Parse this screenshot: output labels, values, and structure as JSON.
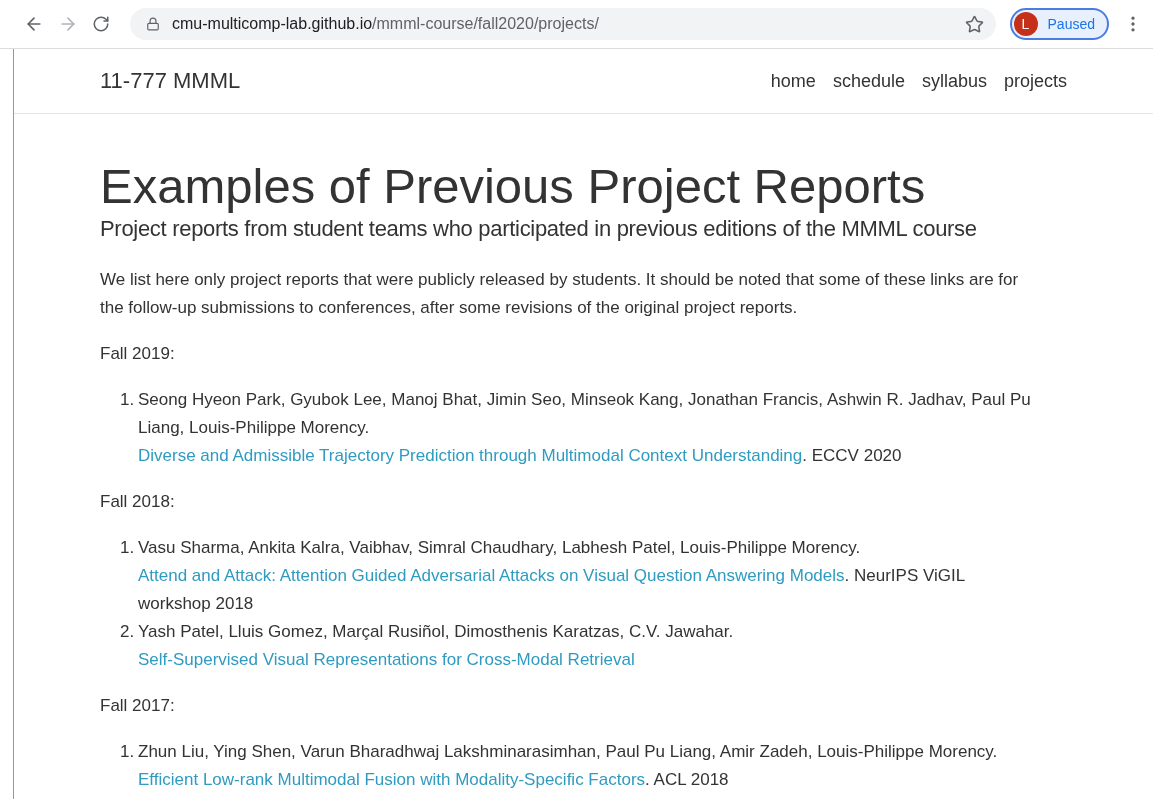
{
  "browser": {
    "url_host": "cmu-multicomp-lab.github.io",
    "url_path": "/mmml-course/fall2020/projects/",
    "profile_initial": "L",
    "profile_status": "Paused"
  },
  "navbar": {
    "brand": "11-777 MMML",
    "links": [
      {
        "label": "home"
      },
      {
        "label": "schedule"
      },
      {
        "label": "syllabus"
      },
      {
        "label": "projects"
      }
    ]
  },
  "header": {
    "title": "Examples of Previous Project Reports",
    "subtitle": "Project reports from student teams who participated in previous editions of the MMML course"
  },
  "intro": "We list here only project reports that were publicly released by students. It should be noted that some of these links are for the follow-up submissions to conferences, after some revisions of the original project reports.",
  "sections": [
    {
      "heading": "Fall 2019:",
      "entries": [
        {
          "number": "1.",
          "authors": "Seong Hyeon Park, Gyubok Lee, Manoj Bhat, Jimin Seo, Minseok Kang, Jonathan Francis, Ashwin R. Jadhav, Paul Pu Liang, Louis-Philippe Morency.",
          "link": "Diverse and Admissible Trajectory Prediction through Multimodal Context Understanding",
          "venue": ". ECCV 2020"
        }
      ]
    },
    {
      "heading": "Fall 2018:",
      "entries": [
        {
          "number": "1.",
          "authors": "Vasu Sharma, Ankita Kalra, Vaibhav, Simral Chaudhary, Labhesh Patel, Louis-Philippe Morency.",
          "link": "Attend and Attack: Attention Guided Adversarial Attacks on Visual Question Answering Models",
          "venue": ". NeurIPS ViGIL workshop 2018"
        },
        {
          "number": "2.",
          "authors": "Yash Patel, Lluis Gomez, Marçal Rusiñol, Dimosthenis Karatzas, C.V. Jawahar.",
          "link": "Self-Supervised Visual Representations for Cross-Modal Retrieval"
        }
      ]
    },
    {
      "heading": "Fall 2017:",
      "entries": [
        {
          "number": "1.",
          "authors": "Zhun Liu, Ying Shen, Varun Bharadhwaj Lakshminarasimhan, Paul Pu Liang, Amir Zadeh, Louis-Philippe Morency.",
          "link": "Efficient Low-rank Multimodal Fusion with Modality-Specific Factors",
          "venue": ". ACL 2018"
        }
      ]
    }
  ]
}
